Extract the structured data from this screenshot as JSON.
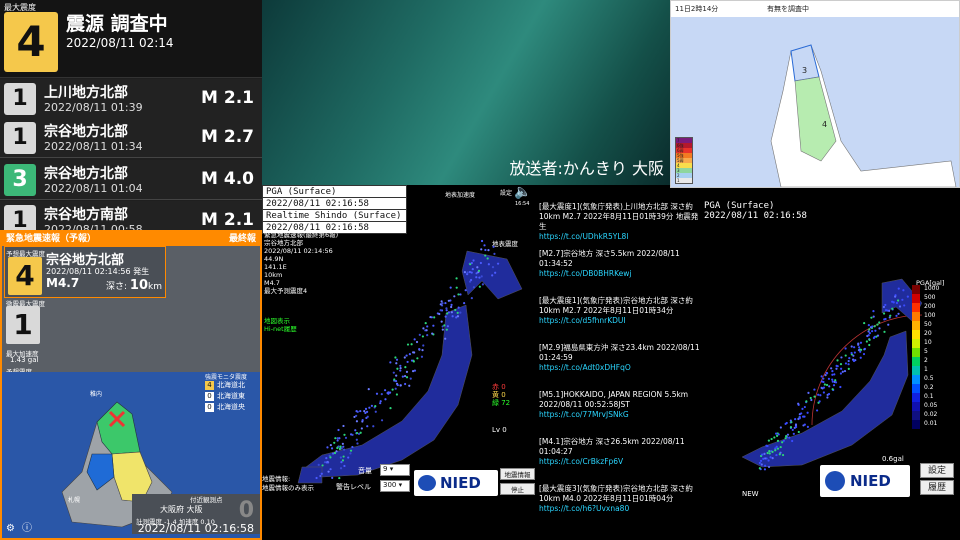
{
  "quake_list": {
    "header": {
      "label": "最大震度",
      "intensity": "4",
      "title": "震源 調査中",
      "time": "2022/08/11 02:14"
    },
    "rows": [
      {
        "intensity": "1",
        "region": "上川地方北部",
        "time": "2022/08/11 01:39",
        "mag": "M 2.1"
      },
      {
        "intensity": "1",
        "region": "宗谷地方北部",
        "time": "2022/08/11 01:34",
        "mag": "M 2.7"
      },
      {
        "intensity": "3",
        "region": "宗谷地方北部",
        "time": "2022/08/11 01:04",
        "mag": "M 4.0"
      },
      {
        "intensity": "1",
        "region": "宗谷地方南部",
        "time": "2022/08/11 00:58",
        "mag": "M 2.1"
      }
    ]
  },
  "eew": {
    "title": "緊急地震速報（予報）",
    "final": "最終報",
    "pred_label": "予想最大震度",
    "pred_int": "4",
    "region": "宗谷地方北部",
    "origin": "2022/08/11 02:14:56 発生",
    "mag": "M4.7",
    "depth_label": "深さ:",
    "depth": "10",
    "depth_unit": "km",
    "micro_label": "微震最大震度",
    "micro_int": "1",
    "acc_label": "最大加速度",
    "acc": "1.43 gal",
    "pred_scale_label": "予想震度",
    "scale": [
      "7",
      "6+",
      "6-",
      "5+",
      "5-",
      "4",
      "3",
      "2",
      "1"
    ],
    "monitor_label": "強震モニタ震度",
    "legend": [
      {
        "n": "4",
        "t": "北海道北"
      },
      {
        "n": "0",
        "t": "北海道東"
      },
      {
        "n": "0",
        "t": "北海道央"
      }
    ],
    "city_nayoro": "稚内",
    "city_sapporo": "札幌",
    "near_label": "付近観測点",
    "osaka_pref": "大阪府 大阪",
    "osaka_val": "0",
    "measure": "計測震度 -1.4 加速度 0.10",
    "clock": "2022/08/11 02:16:58"
  },
  "broadcast": "放送者:かんきり 大阪",
  "inset": {
    "date": "11日2時14分",
    "note": "有無を調査中",
    "int_a": "3",
    "int_b": "4",
    "legend": [
      "7",
      "6強",
      "6弱",
      "5強",
      "5弱",
      "4",
      "3",
      "2",
      "1"
    ]
  },
  "center": {
    "pga": "PGA (Surface)",
    "time1": "2022/08/11 02:16:58",
    "rt": "Realtime Shindo (Surface)",
    "time2": "2022/08/11 02:16:58",
    "label_tr": "地表加速度",
    "settings": "設定",
    "clock": "16:54",
    "label_r": "地表震度",
    "eew_title": "緊急地震速報(最終第6報)",
    "region": "宗谷地方北部",
    "t": "2022/08/11 02:14:56",
    "lat": "44.9N",
    "lon": "141.1E",
    "dep": "10km",
    "mag": "M4.7",
    "pred": "最大予測震度4",
    "map_link": "地図表示",
    "hinet": "Hi-net履歴",
    "stats": {
      "red": "赤 0",
      "yellow": "黄 0",
      "green": "緑 72"
    },
    "lv": "Lv 0",
    "eq_info": "地震情報:",
    "eq_note": "地震情報のみ表示",
    "vol_label": "音量",
    "vol": "9",
    "warn_label": "警告レベル",
    "warn": "300",
    "nied": "NIED",
    "b1": "地震情報",
    "b2": "停止"
  },
  "feed": [
    {
      "t": "[最大震度1](気象庁発表)上川地方北部 深さ約10km M2.7 2022年8月11日01時39分 地震発生",
      "l": "https://t.co/UDhkR5YL8l"
    },
    {
      "t": "[M2.7]宗谷地方 深さ5.5km 2022/08/11 01:34:52",
      "l": "https://t.co/DB0BHRKewj"
    },
    {
      "t": "[最大震度1](気象庁発表)宗谷地方北部 深さ約10km M2.7 2022年8月11日01時34分",
      "l": "https://t.co/d5fhnrKDUI"
    },
    {
      "t": "[M2.9]福島県東方沖 深さ23.4km 2022/08/11 01:24:59",
      "l": "https://t.co/Adt0xDHFqO"
    },
    {
      "t": "[M5.1]HOKKAIDO, JAPAN REGION 5.5km 2022/08/11 00:52:58JST",
      "l": "https://t.co/77MrvJSNkG"
    },
    {
      "t": "[M4.1]宗谷地方 深さ26.5km 2022/08/11 01:04:27",
      "l": "https://t.co/CrBkzFp6V"
    },
    {
      "t": "[最大震度3](気象庁発表)宗谷地方北部 深さ約10km M4.0 2022年8月11日01時04分",
      "l": "https://t.co/h6?Uvxna80"
    }
  ],
  "right": {
    "pga": "PGA (Surface)",
    "time": "2022/08/11 02:16:58",
    "legend_title": "PGA[gal]",
    "ticks": [
      "1000",
      "500",
      "200",
      "100",
      "50",
      "20",
      "10",
      "5",
      "2",
      "1",
      "0.5",
      "0.2",
      "0.1",
      "0.05",
      "0.02",
      "0.01"
    ],
    "gal": "0.6gal",
    "new": "NEW",
    "b1": "設定",
    "b2": "履歴",
    "nied": "NIED"
  }
}
